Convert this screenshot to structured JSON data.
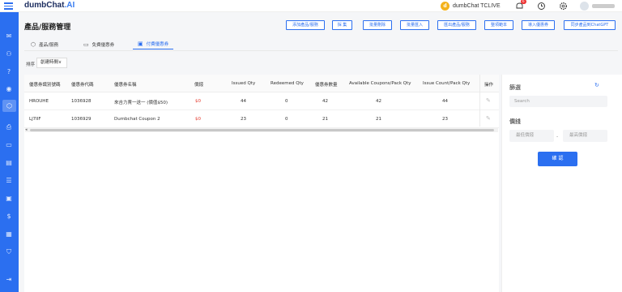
{
  "app": {
    "logo_main": "dumbChat",
    "logo_ai": ".AI"
  },
  "header": {
    "brand_initial": "d",
    "brand_name": "dumbChat TCLIVE",
    "notification_count": "6"
  },
  "page": {
    "title": "產品/服務管理"
  },
  "actions": [
    "添加產品/服務",
    "採 集",
    "批量刪除",
    "批量匯入",
    "匯出產品/服務",
    "整項範本",
    "導入優惠券",
    "同步產品到ChatGPT"
  ],
  "tabs": [
    {
      "label": "產品/服務",
      "icon": "box-icon"
    },
    {
      "label": "免費優惠券",
      "icon": "coupon-icon"
    },
    {
      "label": "付費優惠券",
      "icon": "paid-coupon-icon"
    }
  ],
  "sort": {
    "label": "排序",
    "value": "創建時間∨"
  },
  "table": {
    "columns": [
      "優惠券識別號碼",
      "優惠券代碼",
      "優惠券名稱",
      "價錢",
      "Issued Qty",
      "Redeemed Qty",
      "優惠券數量",
      "Available Coupons/Pack Qty",
      "Issue Count/Pack Qty",
      "操作"
    ],
    "rows": [
      {
        "id": "HROUHE",
        "code": "1036928",
        "name": "來吉力賣一送一 (價值$50)",
        "price": "$0",
        "issued": "44",
        "redeemed": "0",
        "qty": "42",
        "available": "42",
        "issue_count": "44"
      },
      {
        "id": "LJ7IIF",
        "code": "1036929",
        "name": "Dumbchat Coupon 2",
        "price": "$0",
        "issued": "23",
        "redeemed": "0",
        "qty": "21",
        "available": "21",
        "issue_count": "23"
      }
    ]
  },
  "filter": {
    "title": "篩選",
    "search_placeholder": "Search",
    "price_title": "價錢",
    "min_placeholder": "最低價錢",
    "max_placeholder": "最高價錢",
    "dash": "-",
    "confirm": "確 認"
  }
}
